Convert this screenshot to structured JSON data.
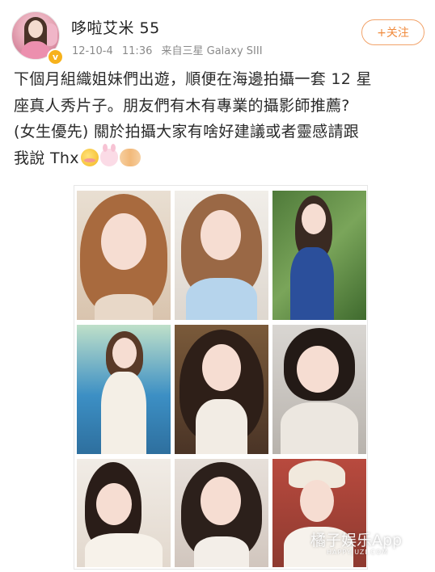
{
  "post": {
    "username": "哆啦艾米 55",
    "date": "12-10-4",
    "time": "11:36",
    "source": "来自三星 Galaxy SIII",
    "verified_badge": "v",
    "follow_label": "+关注",
    "text_lines": [
      "下個月組織姐妹們出遊，順便在海邊拍攝一套 12 星",
      "座真人秀片子。朋友們有木有專業的攝影師推薦?",
      "(女生優先) 關於拍攝大家有啥好建議或者靈感請跟",
      "我說 Thx"
    ],
    "emojis": [
      "bashful-emoji",
      "rabbit-emoji",
      "handshake-emoji"
    ]
  },
  "photo_grid": {
    "count": 9,
    "photos": [
      {
        "name": "photo-portrait-1"
      },
      {
        "name": "photo-portrait-2"
      },
      {
        "name": "photo-portrait-3"
      },
      {
        "name": "photo-portrait-4"
      },
      {
        "name": "photo-portrait-5"
      },
      {
        "name": "photo-portrait-6"
      },
      {
        "name": "photo-portrait-7"
      },
      {
        "name": "photo-portrait-8"
      },
      {
        "name": "photo-portrait-9"
      }
    ]
  },
  "watermark": {
    "text": "橘子娱乐App",
    "subtext": "HAPPYJUZI.COM"
  },
  "colors": {
    "follow_accent": "#f08a3c",
    "verified_badge": "#f7b21c",
    "meta_text": "#8a8a8a"
  }
}
